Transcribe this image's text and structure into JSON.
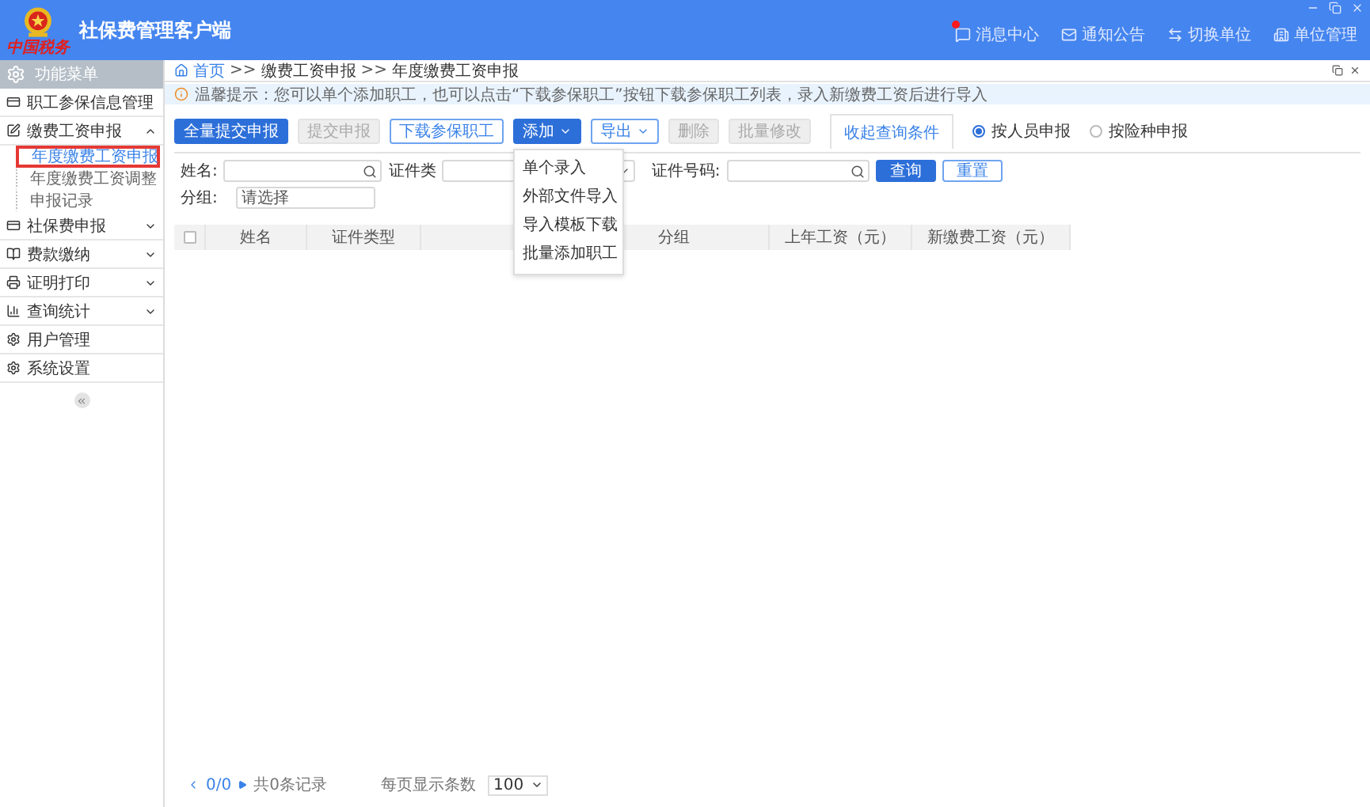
{
  "app": {
    "title": "社保费管理客户端",
    "logo_caption": "中国税务"
  },
  "header_nav": [
    {
      "label": "消息中心",
      "alert": true
    },
    {
      "label": "通知公告",
      "alert": false
    },
    {
      "label": "切换单位",
      "alert": false
    },
    {
      "label": "单位管理",
      "alert": false
    }
  ],
  "sidebar": {
    "title": "功能菜单",
    "items": [
      {
        "label": "职工参保信息管理",
        "kind": "link"
      },
      {
        "label": "缴费工资申报",
        "kind": "group",
        "expanded": true,
        "children": [
          {
            "label": "年度缴费工资申报",
            "selected": true
          },
          {
            "label": "年度缴费工资调整",
            "selected": false
          },
          {
            "label": "申报记录",
            "selected": false
          }
        ]
      },
      {
        "label": "社保费申报",
        "kind": "group",
        "expanded": false
      },
      {
        "label": "费款缴纳",
        "kind": "group",
        "expanded": false
      },
      {
        "label": "证明打印",
        "kind": "group",
        "expanded": false
      },
      {
        "label": "查询统计",
        "kind": "group",
        "expanded": false
      },
      {
        "label": "用户管理",
        "kind": "link"
      },
      {
        "label": "系统设置",
        "kind": "link"
      }
    ]
  },
  "breadcrumb": [
    {
      "text": "首页",
      "kind": "link"
    },
    {
      "text": ">>",
      "kind": "sep"
    },
    {
      "text": "缴费工资申报",
      "kind": "item"
    },
    {
      "text": ">>",
      "kind": "sep"
    },
    {
      "text": "年度缴费工资申报",
      "kind": "item"
    }
  ],
  "notice": "温馨提示：您可以单个添加职工，也可以点击“下载参保职工”按钮下载参保职工列表，录入新缴费工资后进行导入",
  "toolbar": [
    {
      "label": "全量提交申报",
      "kind": "primary"
    },
    {
      "label": "提交申报",
      "kind": "disabled"
    },
    {
      "label": "下载参保职工",
      "kind": "outline"
    },
    {
      "label": "添加",
      "kind": "primary-dropdown"
    },
    {
      "label": "导出",
      "kind": "outline-dropdown"
    },
    {
      "label": "删除",
      "kind": "disabled"
    },
    {
      "label": "批量修改",
      "kind": "disabled"
    }
  ],
  "toggle_tab": "收起查询条件",
  "modes": [
    {
      "label": "按人员申报",
      "selected": true
    },
    {
      "label": "按险种申报",
      "selected": false
    }
  ],
  "add_menu": [
    "单个录入",
    "外部文件导入",
    "导入模板下载",
    "批量添加职工"
  ],
  "search": {
    "name_label": "姓名:",
    "id_type_label": "证件类",
    "id_no_label": "证件号码:",
    "group_label": "分组:",
    "group_value": "请选择",
    "query": "查询",
    "reset": "重置"
  },
  "table": {
    "select_all_checked": false,
    "columns": [
      "姓名",
      "证件类型",
      "分组",
      "上年工资（元）",
      "新缴费工资（元）"
    ]
  },
  "footer": {
    "pages": "0/0",
    "total": "共0条记录",
    "page_size_label": "每页显示条数",
    "page_size": "100"
  }
}
